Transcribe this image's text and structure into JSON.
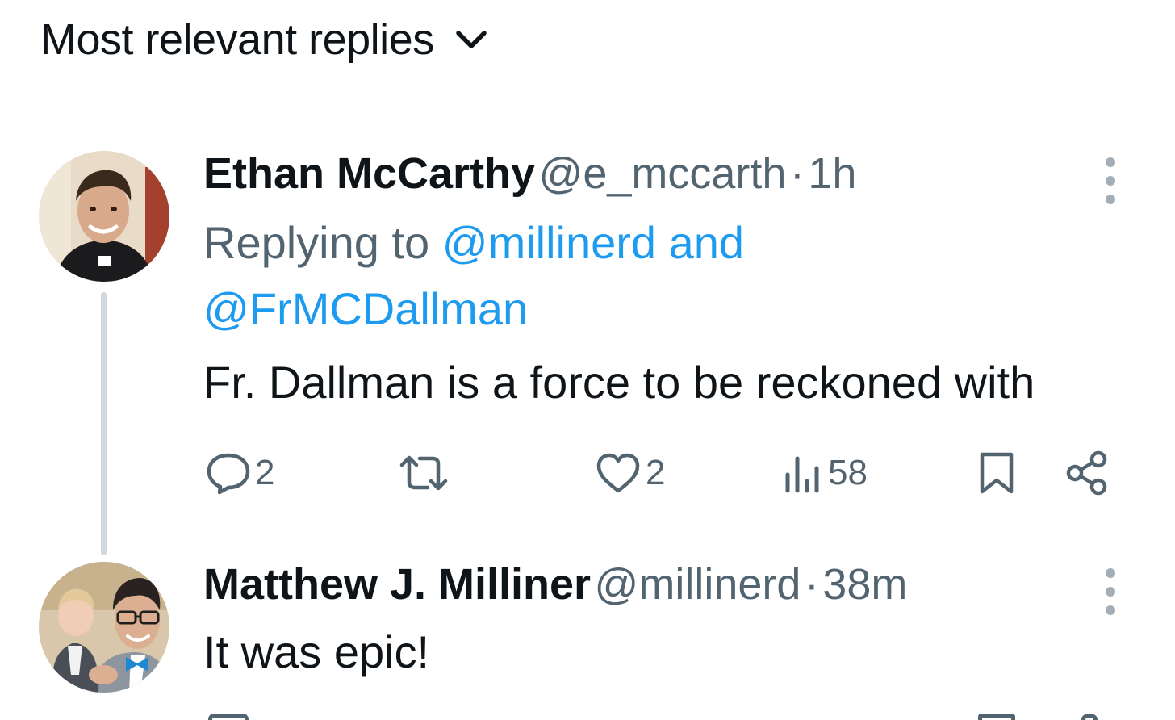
{
  "sort": {
    "label": "Most relevant replies",
    "icon": "chevron-down-icon"
  },
  "replies": [
    {
      "display_name": "Ethan McCarthy",
      "handle": "@e_mccarth",
      "separator": "·",
      "time": "1h",
      "replying_prefix": "Replying to",
      "replying_to_1": "@millinerd",
      "replying_joiner": "and",
      "replying_to_2": "@FrMCDallman",
      "text": "Fr. Dallman is a force to be reckoned with",
      "actions": {
        "reply_count": "2",
        "repost_count": "",
        "like_count": "2",
        "view_count": "58"
      }
    },
    {
      "display_name": "Matthew J. Milliner",
      "handle": "@millinerd",
      "separator": "·",
      "time": "38m",
      "text": "It was epic!"
    }
  ],
  "colors": {
    "text": "#0f1419",
    "muted": "#536471",
    "link": "#1d9bf0",
    "thread_line": "#cfd9de"
  }
}
